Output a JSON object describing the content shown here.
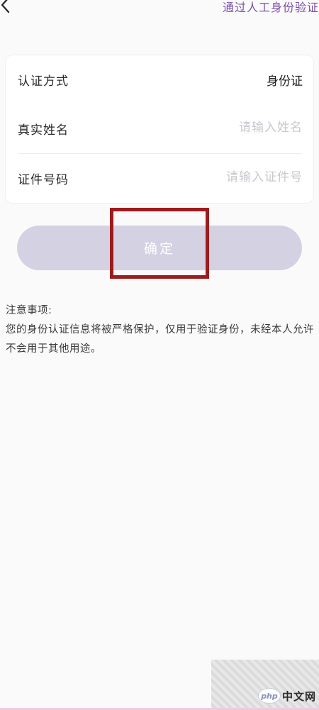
{
  "header": {
    "back_icon": "chevron-left-icon",
    "manual_verify_link": "通过人工身份验证"
  },
  "form": {
    "method": {
      "label": "认证方式",
      "value": "身份证"
    },
    "name": {
      "label": "真实姓名",
      "value": "",
      "placeholder": "请输入姓名"
    },
    "id_number": {
      "label": "证件号码",
      "value": "",
      "placeholder": "请输入证件号"
    }
  },
  "confirm_button": {
    "label": "确定",
    "state": "disabled"
  },
  "notes": {
    "title": "注意事项:",
    "body": "您的身份认证信息将被严格保护，仅用于验证身份，未经本人允许不会用于其他用途。"
  },
  "watermark": {
    "logo_text": "php",
    "site_text": "中文网"
  },
  "colors": {
    "accent": "#7a4fa8",
    "button_disabled": "#d3d1e2",
    "highlight_box": "#9d1c1c",
    "placeholder": "#c8c8cf"
  }
}
